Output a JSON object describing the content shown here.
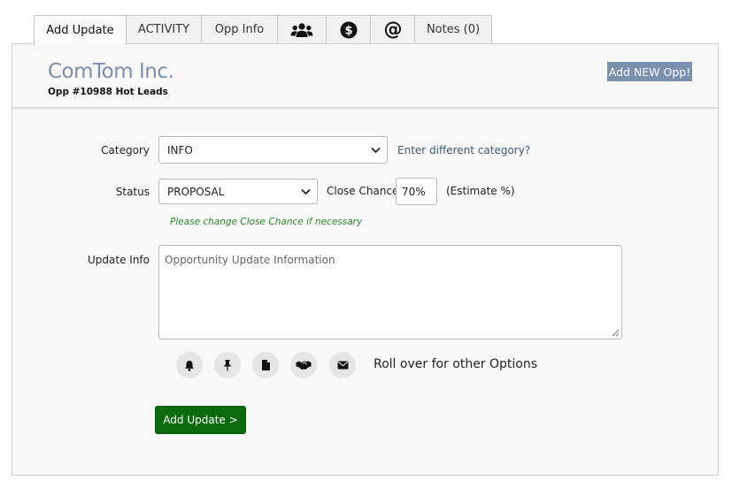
{
  "tabs": {
    "add_update": "Add Update",
    "activity": "ACTIVITY",
    "opp_info": "Opp Info",
    "team_icon": "users-icon",
    "money_icon": "dollar-icon",
    "email_icon": "at-icon",
    "notes": "Notes (0)"
  },
  "header": {
    "company": "ComTom Inc.",
    "opp_number": "Opp #10988 Hot Leads",
    "add_opp_label": "Add NEW Opp!"
  },
  "form": {
    "category_label": "Category",
    "category_value": "INFO",
    "category_link": "Enter different category?",
    "status_label": "Status",
    "status_value": "PROPOSAL",
    "close_chance_label": "Close Chance",
    "close_chance_value": "70%",
    "estimate_label": "(Estimate %)",
    "hint": "Please change Close Chance if necessary",
    "update_info_label": "Update Info",
    "update_info_placeholder": "Opportunity Update Information",
    "rollover_text": "Roll over for other Options",
    "submit_label": "Add Update >"
  },
  "option_icons": [
    "bell-icon",
    "pin-icon",
    "document-icon",
    "handshake-icon",
    "envelope-icon"
  ],
  "colors": {
    "accent": "#7b8fae",
    "submit": "#0b6a0b",
    "hint": "#2d8a2d"
  }
}
